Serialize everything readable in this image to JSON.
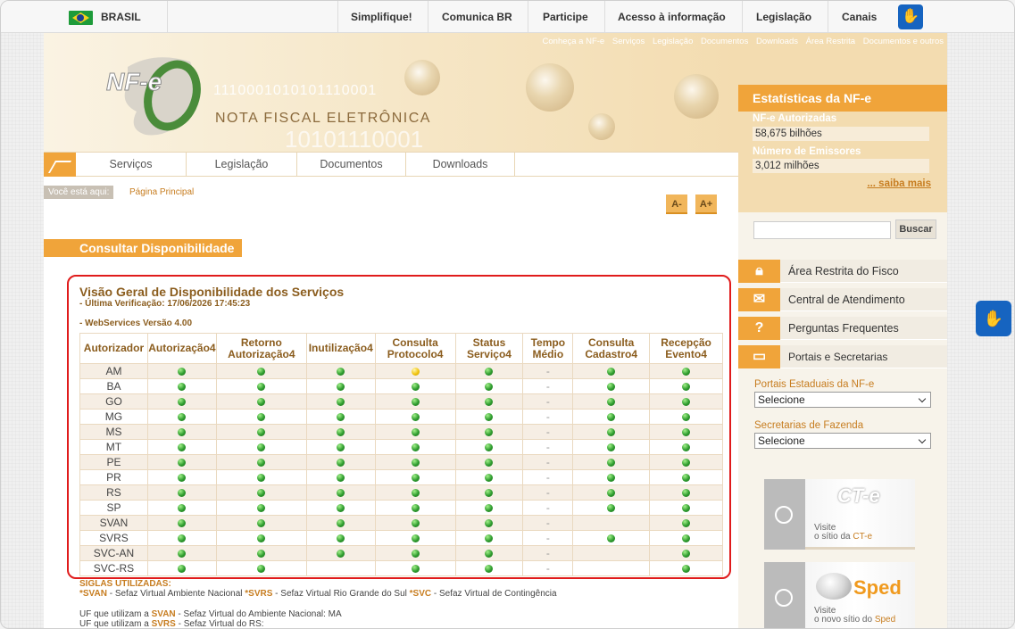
{
  "gov": {
    "country": "BRASIL",
    "links": [
      "Simplifique!",
      "Comunica BR",
      "Participe",
      "Acesso à informação",
      "Legislação",
      "Canais"
    ]
  },
  "header": {
    "toplinks": [
      "Conheça a NF-e",
      "Serviços",
      "Legislação",
      "Documentos",
      "Downloads",
      "Área Restrita",
      "Documentos e outros"
    ],
    "logo_text": "NF-e",
    "title": "NOTA FISCAL ELETRÔNICA",
    "binary": "1110001010101110001",
    "binary2": "10101110001"
  },
  "nav": {
    "items": [
      "Serviços",
      "Legislação",
      "Documentos",
      "Downloads"
    ]
  },
  "breadcrumb": {
    "label": "Você está aqui:",
    "current": "Página Principal"
  },
  "font_buttons": {
    "decrease": "A-",
    "increase": "A+"
  },
  "section_title": "Consultar Disponibilidade",
  "panel": {
    "title": "Visão Geral de Disponibilidade dos Serviços",
    "last_check": "- Última Verificação: 17/06/2026 17:45:23",
    "version": "- WebServices Versão 4.00",
    "headers": [
      "Autorizador",
      "Autorização4",
      "Retorno Autorização4",
      "Inutilização4",
      "Consulta Protocolo4",
      "Status Serviço4",
      "Tempo Médio",
      "Consulta Cadastro4",
      "Recepção Evento4"
    ],
    "rows": [
      {
        "name": "AM",
        "s": [
          "g",
          "g",
          "g",
          "y",
          "g",
          "-",
          "g",
          "g"
        ]
      },
      {
        "name": "BA",
        "s": [
          "g",
          "g",
          "g",
          "g",
          "g",
          "-",
          "g",
          "g"
        ]
      },
      {
        "name": "GO",
        "s": [
          "g",
          "g",
          "g",
          "g",
          "g",
          "-",
          "g",
          "g"
        ]
      },
      {
        "name": "MG",
        "s": [
          "g",
          "g",
          "g",
          "g",
          "g",
          "-",
          "g",
          "g"
        ]
      },
      {
        "name": "MS",
        "s": [
          "g",
          "g",
          "g",
          "g",
          "g",
          "-",
          "g",
          "g"
        ]
      },
      {
        "name": "MT",
        "s": [
          "g",
          "g",
          "g",
          "g",
          "g",
          "-",
          "g",
          "g"
        ]
      },
      {
        "name": "PE",
        "s": [
          "g",
          "g",
          "g",
          "g",
          "g",
          "-",
          "g",
          "g"
        ]
      },
      {
        "name": "PR",
        "s": [
          "g",
          "g",
          "g",
          "g",
          "g",
          "-",
          "g",
          "g"
        ]
      },
      {
        "name": "RS",
        "s": [
          "g",
          "g",
          "g",
          "g",
          "g",
          "-",
          "g",
          "g"
        ]
      },
      {
        "name": "SP",
        "s": [
          "g",
          "g",
          "g",
          "g",
          "g",
          "-",
          "g",
          "g"
        ]
      },
      {
        "name": "SVAN",
        "s": [
          "g",
          "g",
          "g",
          "g",
          "g",
          "-",
          "",
          "g"
        ]
      },
      {
        "name": "SVRS",
        "s": [
          "g",
          "g",
          "g",
          "g",
          "g",
          "-",
          "g",
          "g"
        ]
      },
      {
        "name": "SVC-AN",
        "s": [
          "g",
          "g",
          "g",
          "g",
          "g",
          "-",
          "",
          "g"
        ]
      },
      {
        "name": "SVC-RS",
        "s": [
          "g",
          "g",
          "",
          "g",
          "g",
          "-",
          "",
          "g"
        ]
      }
    ]
  },
  "siglas": {
    "title": "SIGLAS UTILIZADAS:",
    "svan_code": "*SVAN",
    "svan_text": " - Sefaz Virtual Ambiente Nacional ",
    "svrs_code": "*SVRS",
    "svrs_text": " - Sefaz Virtual Rio Grande do Sul ",
    "svc_code": "*SVC",
    "svc_text": " - Sefaz Virtual de Contingência"
  },
  "uf": {
    "line1_pre": "UF que utilizam a ",
    "line1_code": "SVAN",
    "line1_post": " - Sefaz Virtual do Ambiente Nacional: MA",
    "line2_pre": "UF que utilizam a ",
    "line2_code": "SVRS",
    "line2_post": " - Sefaz Virtual do RS:"
  },
  "sidebar": {
    "stats_title": "Estatísticas da NF-e",
    "authorized_label": "NF-e Autorizadas",
    "authorized_value": "58,675 bilhões",
    "issuers_label": "Número de Emissores",
    "issuers_value": "3,012 milhões",
    "more": "... saiba mais",
    "search_button": "Buscar",
    "menu": [
      "Área Restrita do Fisco",
      "Central de Atendimento",
      "Perguntas Frequentes",
      "Portais e Secretarias"
    ],
    "portais_label": "Portais Estaduais da NF-e",
    "portais_value": "Selecione",
    "secretarias_label": "Secretarias de Fazenda",
    "secretarias_value": "Selecione",
    "cte_logo": "CT-e",
    "cte_visit": "Visite",
    "cte_site_pre": "o sítio da ",
    "cte_site": "CT-e",
    "sped_logo": "Sped",
    "sped_visit": "Visite",
    "sped_site_pre": "o novo sítio do ",
    "sped_site": "Sped"
  }
}
